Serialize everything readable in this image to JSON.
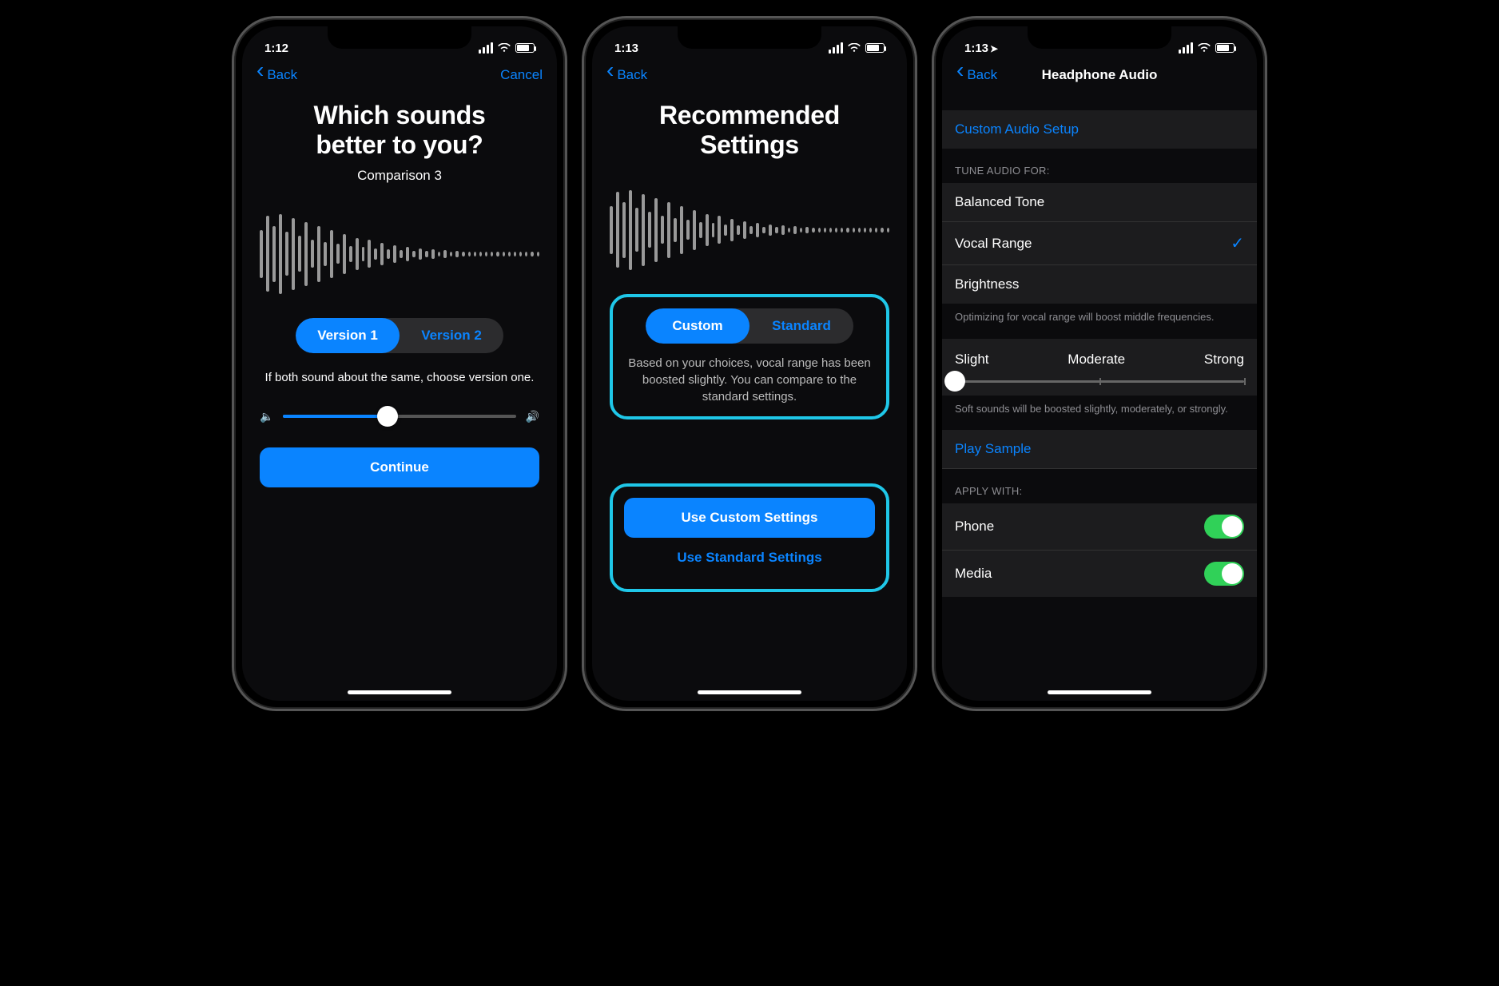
{
  "screen1": {
    "time": "1:12",
    "back": "Back",
    "cancel": "Cancel",
    "title_line1": "Which sounds",
    "title_line2": "better to you?",
    "subtitle": "Comparison 3",
    "seg": {
      "v1": "Version 1",
      "v2": "Version 2"
    },
    "hint": "If both sound about the same, choose version one.",
    "continue": "Continue",
    "volume_pct": 45
  },
  "screen2": {
    "time": "1:13",
    "back": "Back",
    "title_line1": "Recommended",
    "title_line2": "Settings",
    "seg": {
      "custom": "Custom",
      "standard": "Standard"
    },
    "desc": "Based on your choices, vocal range has been boosted slightly. You can compare to the standard settings.",
    "primary": "Use Custom Settings",
    "secondary": "Use Standard Settings"
  },
  "screen3": {
    "time": "1:13",
    "back": "Back",
    "title": "Headphone Audio",
    "custom_setup": "Custom Audio Setup",
    "tune_header": "TUNE AUDIO FOR:",
    "tune_options": [
      "Balanced Tone",
      "Vocal Range",
      "Brightness"
    ],
    "tune_selected_index": 1,
    "tune_footer": "Optimizing for vocal range will boost middle frequencies.",
    "intensity": {
      "left": "Slight",
      "mid": "Moderate",
      "right": "Strong"
    },
    "intensity_footer": "Soft sounds will be boosted slightly, moderately, or strongly.",
    "play_sample": "Play Sample",
    "apply_header": "APPLY WITH:",
    "apply": [
      {
        "label": "Phone",
        "on": true
      },
      {
        "label": "Media",
        "on": true
      }
    ]
  }
}
